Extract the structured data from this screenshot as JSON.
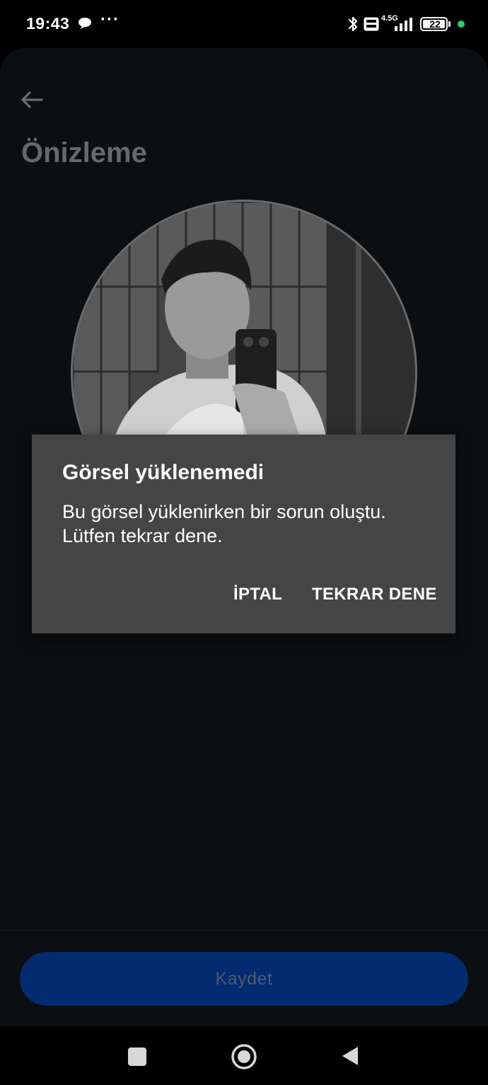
{
  "status_bar": {
    "time": "19:43",
    "network_label": "4.5G",
    "battery": "22",
    "icons": [
      "chat-icon",
      "more-dots-icon",
      "bluetooth-icon",
      "volte-icon",
      "signal-icon",
      "battery-icon"
    ]
  },
  "header": {
    "title": "Önizleme",
    "back_icon": "arrow-left-icon"
  },
  "dialog": {
    "title": "Görsel yüklenemedi",
    "message": "Bu görsel yüklenirken bir sorun oluştu. Lütfen tekrar dene.",
    "cancel_label": "İPTAL",
    "retry_label": "TEKRAR DENE"
  },
  "footer": {
    "save_label": "Kaydet"
  },
  "colors": {
    "screen_bg": "#0b0f12",
    "dialog_bg": "#454545",
    "save_button_bg": "#042a6f",
    "status_dot": "#2ecc71"
  }
}
